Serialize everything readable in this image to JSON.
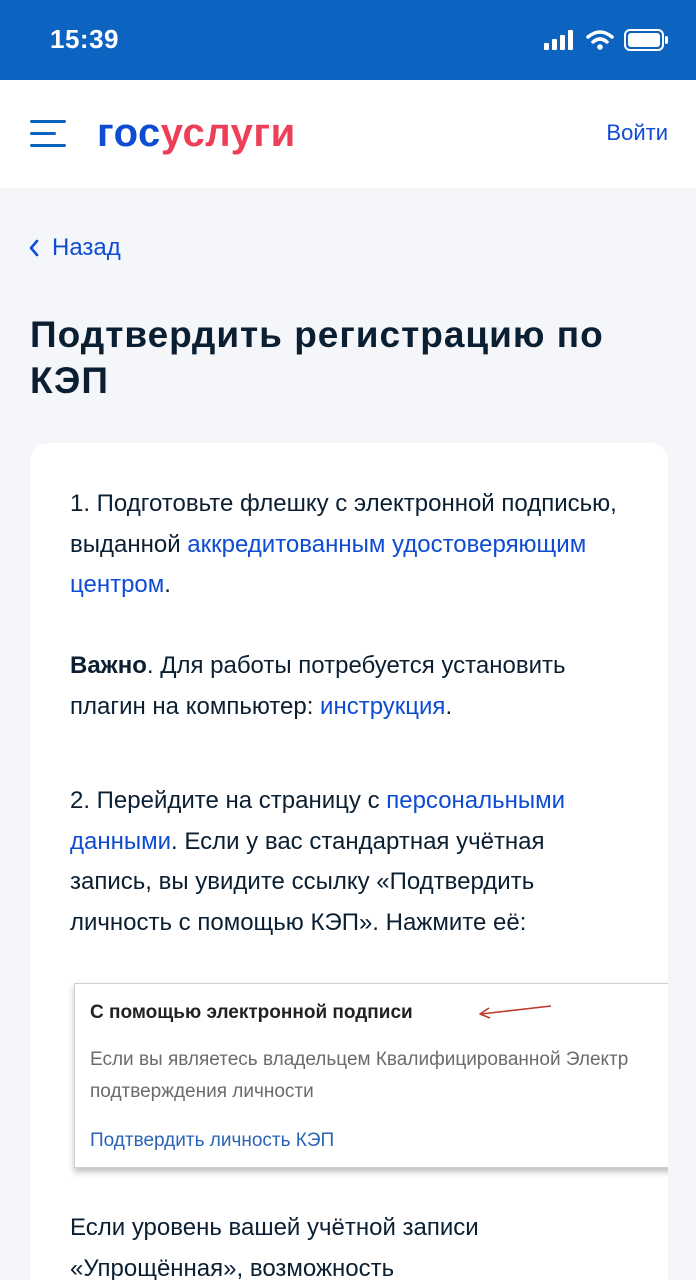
{
  "status_bar": {
    "time": "15:39"
  },
  "header": {
    "logo_part1": "гос",
    "logo_part2": "услуги",
    "login_label": "Войти"
  },
  "back_label": "Назад",
  "page_title": "Подтвердить регистрацию по КЭП",
  "step1": {
    "text_before": "1. Подготовьте флешку с электронной подписью, выданной ",
    "link": "аккредитованным удостоверяющим центром",
    "text_after": "."
  },
  "important": {
    "bold": "Важно",
    "text": ". Для работы потребуется установить плагин на компьютер: ",
    "link": "инструкция",
    "text_after": "."
  },
  "step2": {
    "text_before": "2. Перейдите на страницу с ",
    "link": "персональными данными",
    "text_after": ". Если у вас стандартная учётная запись, вы увидите ссылку «Подтвердить личность с помощью КЭП». Нажмите её:"
  },
  "screenshot": {
    "title": "С помощью электронной подписи",
    "desc_line1": "Если вы являетесь владельцем Квалифицированной Электр",
    "desc_line2": "подтверждения личности",
    "link": "Подтвердить личность КЭП"
  },
  "bottom_text": "Если уровень вашей учётной записи «Упрощённая», возможность",
  "colors": {
    "status_bar": "#0d64c0",
    "link": "#0d4cd3",
    "logo_red": "#ee3f58",
    "background": "#f4f6f9"
  },
  "icons": [
    "menu-icon",
    "chevron-left-icon",
    "signal-icon",
    "wifi-icon",
    "battery-icon",
    "arrow-icon"
  ]
}
